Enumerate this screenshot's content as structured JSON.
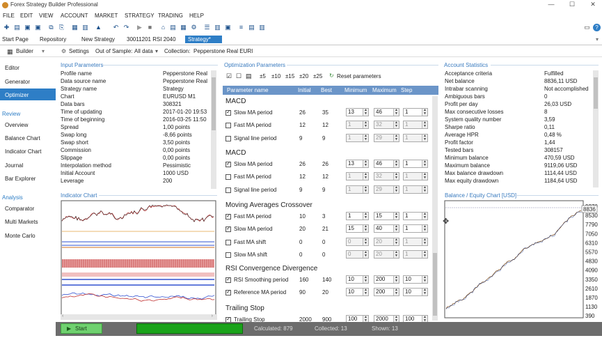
{
  "window": {
    "title": "Forex Strategy Builder Professional",
    "minimize": "—",
    "maximize": "☐",
    "close": "✕"
  },
  "menu": [
    "FILE",
    "EDIT",
    "VIEW",
    "ACCOUNT",
    "MARKET",
    "STRATEGY",
    "TRADING",
    "HELP"
  ],
  "tabs": [
    "Start Page",
    "Repository",
    "New Strategy",
    "30011201 RSI 2040",
    "Strategy*"
  ],
  "subbar": {
    "builder": "Builder",
    "settings": "Settings",
    "oos_label": "Out of Sample:",
    "oos_value": "All data",
    "collection_label": "Collection:",
    "collection_value": "Pepperstone Real EURI"
  },
  "nav": {
    "items": [
      "Editor",
      "Generator",
      "Optimizer"
    ],
    "review_label": "Review",
    "review": [
      "Overview",
      "Balance Chart",
      "Indicator Chart",
      "Journal",
      "Bar Explorer"
    ],
    "analysis_label": "Analysis",
    "analysis": [
      "Comparator",
      "Multi Markets",
      "Monte Carlo"
    ]
  },
  "input_params": {
    "title": "Input Parameters",
    "rows": [
      [
        "Profile name",
        "Pepperstone Real"
      ],
      [
        "Data source name",
        "Pepperstone Real"
      ],
      [
        "Strategy name",
        "Strategy"
      ],
      [
        "Chart",
        "EURUSD M1"
      ],
      [
        "Data bars",
        "308321"
      ],
      [
        "Time of updating",
        "2017-01-20 19:53"
      ],
      [
        "Time of beginning",
        "2016-03-25 11:50"
      ],
      [
        "Spread",
        "1,00 points"
      ],
      [
        "Swap long",
        "-8,66 points"
      ],
      [
        "Swap short",
        "3,50 points"
      ],
      [
        "Commission",
        "0,00 points"
      ],
      [
        "Slippage",
        "0,00 points"
      ],
      [
        "Interpolation method",
        "Pessimistic"
      ],
      [
        "Initial Account",
        "1000 USD"
      ],
      [
        "Leverage",
        "200"
      ]
    ]
  },
  "indicator_chart": {
    "title": "Indicator Chart"
  },
  "optimization": {
    "title": "Optimization Parameters",
    "steps": [
      "±5",
      "±10",
      "±15",
      "±20",
      "±25"
    ],
    "reset": "Reset parameters",
    "columns": [
      "Parameter name",
      "Initial",
      "Best",
      "Minimum",
      "Maximum",
      "Step"
    ],
    "groups": [
      {
        "name": "MACD",
        "params": [
          [
            "Slow MA period",
            "26",
            "35",
            "13",
            "46",
            "1",
            true
          ],
          [
            "Fast MA period",
            "12",
            "12",
            "1",
            "32",
            "1",
            false
          ],
          [
            "Signal line period",
            "9",
            "9",
            "1",
            "29",
            "1",
            false
          ]
        ]
      },
      {
        "name": "MACD",
        "params": [
          [
            "Slow MA period",
            "26",
            "26",
            "13",
            "46",
            "1",
            true
          ],
          [
            "Fast MA period",
            "12",
            "12",
            "1",
            "32",
            "1",
            false
          ],
          [
            "Signal line period",
            "9",
            "9",
            "1",
            "29",
            "1",
            false
          ]
        ]
      },
      {
        "name": "Moving Averages Crossover",
        "params": [
          [
            "Fast MA period",
            "10",
            "3",
            "1",
            "15",
            "1",
            true
          ],
          [
            "Slow MA period",
            "20",
            "21",
            "15",
            "40",
            "1",
            true
          ],
          [
            "Fast MA shift",
            "0",
            "0",
            "0",
            "20",
            "1",
            false
          ],
          [
            "Slow MA shift",
            "0",
            "0",
            "0",
            "20",
            "1",
            false
          ]
        ]
      },
      {
        "name": "RSI Convergence Divergence",
        "params": [
          [
            "RSI Smoothing period",
            "160",
            "140",
            "10",
            "200",
            "10",
            true
          ],
          [
            "Reference MA period",
            "90",
            "20",
            "10",
            "200",
            "10",
            true
          ]
        ]
      },
      {
        "name": "Trailing Stop",
        "params": [
          [
            "Trailing Stop",
            "2000",
            "900",
            "100",
            "2000",
            "100",
            true
          ]
        ]
      }
    ]
  },
  "account_stats": {
    "title": "Account Statistics",
    "rows": [
      [
        "Acceptance criteria",
        "Fulfilled"
      ],
      [
        "Net balance",
        "8836,11 USD"
      ],
      [
        "Intrabar scanning",
        "Not accomplished"
      ],
      [
        "Ambiguous bars",
        "0"
      ],
      [
        "Profit per day",
        "26,03 USD"
      ],
      [
        "Max consecutive losses",
        "8"
      ],
      [
        "System quality number",
        "3,59"
      ],
      [
        "Sharpe ratio",
        "0,11"
      ],
      [
        "Average HPR",
        "0,48 %"
      ],
      [
        "Profit factor",
        "1,44"
      ],
      [
        "Tested bars",
        "308157"
      ],
      [
        "Minimum balance",
        "470,59 USD"
      ],
      [
        "Maximum balance",
        "9119,06 USD"
      ],
      [
        "Max balance drawdown",
        "1114,44 USD"
      ],
      [
        "Max equity drawdown",
        "1184,64 USD"
      ]
    ]
  },
  "balance_chart": {
    "title": "Balance / Equity Chart [USD]",
    "current": "8836",
    "ticks": [
      "9270",
      "8530",
      "7790",
      "7050",
      "6310",
      "5570",
      "4830",
      "4090",
      "3350",
      "2610",
      "1870",
      "1130",
      "390"
    ]
  },
  "status": {
    "start": "Start",
    "calculated": "Calculated: 879",
    "collected": "Collected: 13",
    "shown": "Shown: 13"
  },
  "colors": {
    "accent": "#2e7ec6",
    "header": "#6b95c8",
    "progress": "#1aa31a"
  }
}
